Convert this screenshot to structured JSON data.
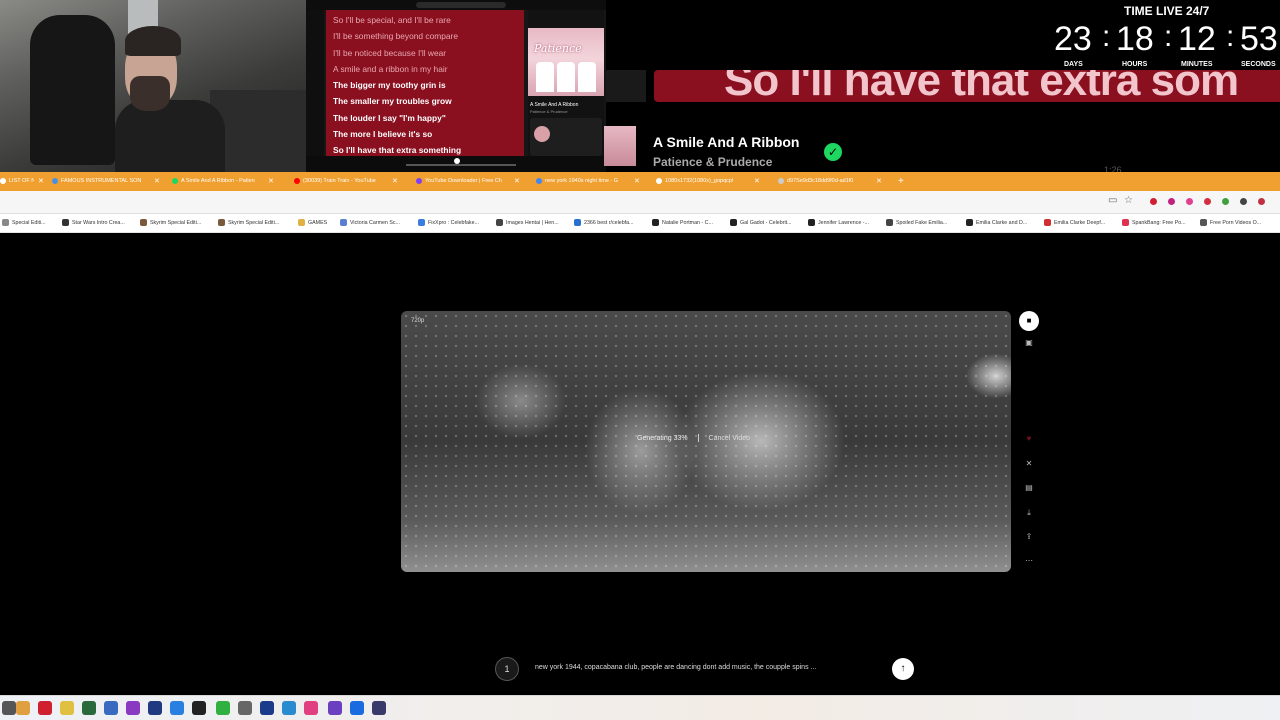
{
  "overlay": {
    "lyrics": [
      {
        "text": "So I'll be special, and I'll be rare",
        "active": false
      },
      {
        "text": "I'll be something beyond compare",
        "active": false
      },
      {
        "text": "I'll be noticed because I'll wear",
        "active": false
      },
      {
        "text": "A smile and a ribbon in my hair",
        "active": false
      },
      {
        "text": "The bigger my toothy grin is",
        "active": true
      },
      {
        "text": "The smaller my troubles grow",
        "active": true
      },
      {
        "text": "The louder I say \"I'm happy\"",
        "active": true
      },
      {
        "text": "The more I believe it's so",
        "active": true
      },
      {
        "text": "So I'll have that extra something",
        "active": true
      }
    ],
    "banner_lyric": "So I'll have that extra som",
    "now_playing": {
      "title": "A Smile And A Ribbon",
      "artist": "Patience & Prudence",
      "time": "1:26"
    },
    "clock": {
      "title": "TIME LIVE 24/7",
      "days": "23",
      "hours": "18",
      "minutes": "12",
      "seconds": "53",
      "days_label": "DAYS",
      "hours_label": "HOURS",
      "minutes_label": "MINUTES",
      "seconds_label": "SECONDS"
    }
  },
  "browser": {
    "tabs": [
      {
        "label": "LIST OF NC",
        "color": "#ffffff"
      },
      {
        "label": "FAMOUS INSTRUMENTAL SON",
        "color": "#4a90e2"
      },
      {
        "label": "A Smile And A Ribbon - Patien",
        "color": "#1ed760"
      },
      {
        "label": "(30039) Train Train - YouTube",
        "color": "#ff0000"
      },
      {
        "label": "YouTube Downloader | Free Ch",
        "color": "#7e3ff2"
      },
      {
        "label": "new york 1940s night time - G",
        "color": "#4285f4"
      },
      {
        "label": "1080x1732(1080x)_gopqcpl",
        "color": "#ffffff"
      },
      {
        "label": "d97Se9d3c18dd9f0d-ad1f0",
        "color": "#cccccc"
      }
    ],
    "bookmarks": [
      {
        "label": "Special Editi...",
        "color": "#888888"
      },
      {
        "label": "Star Wars Intro Crea...",
        "color": "#333333"
      },
      {
        "label": "Skyrim Special Editi...",
        "color": "#7a5a3a"
      },
      {
        "label": "Skyrim Special Editi...",
        "color": "#7a5a3a"
      },
      {
        "label": "GAMES",
        "color": "#e0b040"
      },
      {
        "label": "Victoria Carmen Sc...",
        "color": "#5b7fd0"
      },
      {
        "label": "FixXpro : Celebfake...",
        "color": "#3a7de0"
      },
      {
        "label": "Images Hentai | Hen...",
        "color": "#444444"
      },
      {
        "label": "2366 best r/celebfa...",
        "color": "#2a6fd0"
      },
      {
        "label": "Natalie Portman - C...",
        "color": "#222222"
      },
      {
        "label": "Gal Gadot - Celebrit...",
        "color": "#222222"
      },
      {
        "label": "Jennifer Lawrence -...",
        "color": "#222222"
      },
      {
        "label": "Spoiled Fake Emilia...",
        "color": "#444444"
      },
      {
        "label": "Emilia Clarke and D...",
        "color": "#222222"
      },
      {
        "label": "Emilia Clarke Deepf...",
        "color": "#d03030"
      },
      {
        "label": "SpankBang: Free Po...",
        "color": "#e03050"
      },
      {
        "label": "Free Porn Videos O...",
        "color": "#555555"
      }
    ]
  },
  "video": {
    "resolution": "720p",
    "status": "Generating",
    "progress": "33%",
    "progress_value": 0.33,
    "cancel_label": "Cancel Video"
  },
  "sidebar": {
    "buttons": [
      "video-icon",
      "image-icon",
      "heart-icon",
      "close-icon",
      "edit-icon",
      "download-icon",
      "share-icon",
      "more-icon"
    ]
  },
  "prompt": {
    "avatar_text": "1",
    "text": "new york 1944, copacabana club, people are dancing dont add music, the coupple spins ..."
  }
}
